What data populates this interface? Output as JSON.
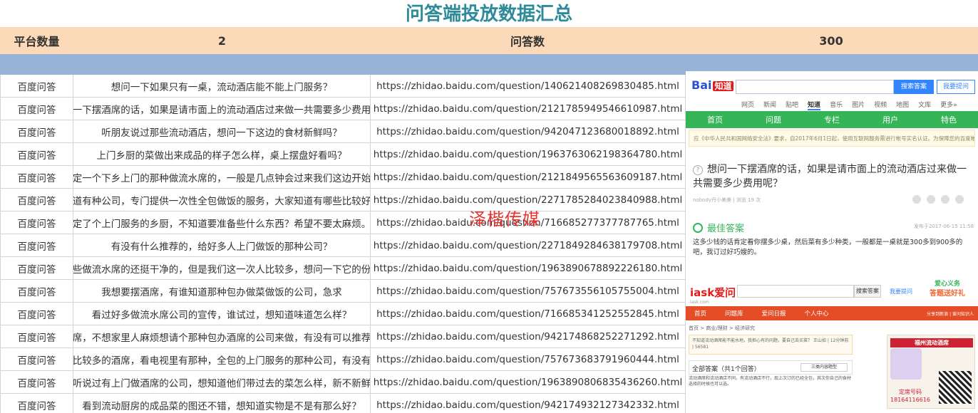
{
  "title": "问答端投放数据汇总",
  "summary": {
    "platform_count_label": "平台数量",
    "platform_count": "2",
    "qa_count_label": "问答数",
    "qa_count": "300"
  },
  "rows": [
    {
      "platform": "百度问答",
      "question": "想问一下如果只有一桌，流动酒店能不能上门服务？",
      "url": "https://zhidao.baidu.com/question/140621408269830485.html"
    },
    {
      "platform": "百度问答",
      "question": "问一下摆酒席的话，如果是请市面上的流动酒店过来做一共需要多少费用呢",
      "url": "https://zhidao.baidu.com/question/2121785949546610987.html"
    },
    {
      "platform": "百度问答",
      "question": "听朋友说过那些流动酒店，想问一下这边的食材新鲜吗？",
      "url": "https://zhidao.baidu.com/question/942047123680018892.html"
    },
    {
      "platform": "百度问答",
      "question": "上门乡厨的菜做出来成品的样子怎么样，桌上摆盘好看吗？",
      "url": "https://zhidao.baidu.com/question/1963763062198364780.html"
    },
    {
      "platform": "百度问答",
      "question": "预定一个下乡上门的那种做流水席的，一般是几点钟会过来我们这边开始做",
      "url": "https://zhidao.baidu.com/question/2121849565563609187.html"
    },
    {
      "platform": "百度问答",
      "question": "知道有种公司，专门提供一次性全包做饭的服务，大家知道有哪些比较好的",
      "url": "https://zhidao.baidu.com/question/2271785284023840988.html"
    },
    {
      "platform": "百度问答",
      "question": "定了个上门服务的乡厨，不知道要准备些什么东西？希望不要太麻烦。",
      "url": "https://zhidao.baidu.com/question/716685277377787765.html"
    },
    {
      "platform": "百度问答",
      "question": "有没有什么推荐的，给好多人上门做饭的那种公司？",
      "url": "https://zhidao.baidu.com/question/2271849284638179708.html"
    },
    {
      "platform": "百度问答",
      "question": "那些做流水席的还挺干净的，但是我们这一次人比较多，想问一下它的份量",
      "url": "https://zhidao.baidu.com/question/1963890678892226180.html"
    },
    {
      "platform": "百度问答",
      "question": "我想要摆酒席，有谁知道那种包办做菜做饭的公司，急求",
      "url": "https://zhidao.baidu.com/question/757673556105755004.html"
    },
    {
      "platform": "百度问答",
      "question": "看过好多做流水席公司的宣传，谁试过，想知道味道怎么样？",
      "url": "https://zhidao.baidu.com/question/716685341252552845.html"
    },
    {
      "platform": "百度问答",
      "question": "酒席，不想家里人麻烦想请个那种包办酒席的公司来做，有没有可以推荐的",
      "url": "https://zhidao.baidu.com/question/942174868252271292.html"
    },
    {
      "platform": "百度问答",
      "question": "有比较多的酒席，看电视里有那种，全包的上门服务的那种公司，有没有可",
      "url": "https://zhidao.baidu.com/question/757673683791960444.html"
    },
    {
      "platform": "百度问答",
      "question": "有听说过有上门做酒席的公司，想知道他们带过去的菜怎么样，新不新鲜？",
      "url": "https://zhidao.baidu.com/question/1963890806835436260.html"
    },
    {
      "platform": "百度问答",
      "question": "看到流动厨房的成品菜的图还不错，想知道实物是不是有那么好？",
      "url": "https://zhidao.baidu.com/question/942174932127342332.html"
    }
  ],
  "watermark": "泽楷传媒",
  "baidu": {
    "logo": "Bai",
    "logo_tag": "知道",
    "search_button": "搜索答案",
    "ask_button": "我要提问",
    "nav": [
      "网页",
      "新闻",
      "贴吧",
      "知道",
      "音乐",
      "图片",
      "视频",
      "地图",
      "文库",
      "更多»"
    ],
    "nav_active": "知道",
    "green_nav": [
      "首页",
      "问题",
      "专栏",
      "用户",
      "特色"
    ],
    "notice": "应《中华人民共和国网络安全法》要求，自2017年6月1日起，使用互联网服务需进行帐号实名认证。为保障您的百度帐号能够正常使用",
    "question": "想问一下摆酒席的话，如果是请市面上的流动酒店过来做一共需要多少费用呢？",
    "meta": "nobody丹小美美 | 浏览 19 次",
    "best_label": "最佳答案",
    "best_date": "发布于2017-06-15 11:58",
    "answer": "这多少钱的话肯定看你摆多少桌，然后菜有多少种类，一般都是一桌就是300多到900多的吧，我订过好巧嫂的。"
  },
  "iask": {
    "logo": "iask爱问",
    "logo_sub": "iask.com",
    "search_button": "搜索答案",
    "ask_link": "我要提问",
    "ad_line1": "爱心义务",
    "ad_line2": "答题送好礼",
    "nav": [
      "首页",
      "问题库",
      "爱问日报",
      "个人中心"
    ],
    "nav_right": "分享到新浪 | 爱问知识人",
    "breadcrumb": "首页 > 商业/理财 > 经济研究",
    "qbox": "不知道流动酒席能不能水地，我担心有的问题，要自己去买菜？ 王山如 | 12分钟前 | 56581",
    "all_answers": "全部答案（共1个回答）",
    "tab": "三类内容题型",
    "answer_body": "流动酒席和流动酒店不同，有流动酒店不行，现上次订的已经全包，其次你自己的食材选择的时候也可以选。",
    "card_title": "福州流动酒席",
    "card_hotline_label": "定席号码",
    "card_hotline": "18164116616"
  }
}
